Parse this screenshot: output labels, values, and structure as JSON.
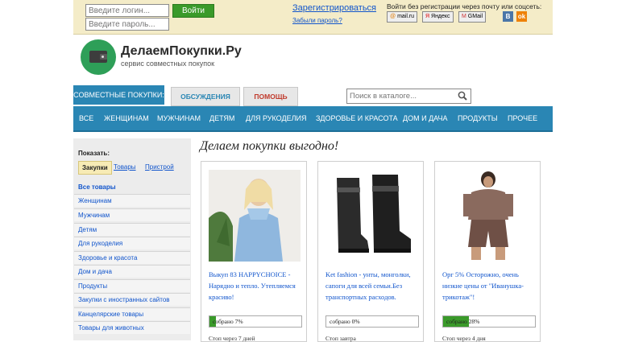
{
  "login": {
    "login_placeholder": "Введите логин...",
    "password_placeholder": "Введите пароль...",
    "submit_label": "Войти",
    "register_link": "Зарегистрироваться",
    "forgot_link": "Забыли пароль?"
  },
  "social": {
    "title": "Войти без регистрации через почту или соцсеть:",
    "buttons": [
      "mail.ru",
      "Яндекс",
      "GMail"
    ],
    "vk": "B",
    "ok": "ok"
  },
  "header": {
    "site_title": "ДелаемПокупки.Ру",
    "tagline": "сервис совместных покупок"
  },
  "tabs": {
    "joint_purchases": "СОВМЕСТНЫЕ ПОКУПКИ:",
    "discussions": "ОБСУЖДЕНИЯ",
    "help": "ПОМОЩЬ"
  },
  "search": {
    "placeholder": "Поиск в каталоге..."
  },
  "nav": [
    "ВСЕ",
    "ЖЕНЩИНАМ",
    "МУЖЧИНАМ",
    "ДЕТЯМ",
    "ДЛЯ РУКОДЕЛИЯ",
    "ЗДОРОВЬЕ И КРАСОТА",
    "ДОМ И ДАЧА",
    "ПРОДУКТЫ",
    "ПРОЧЕЕ"
  ],
  "sidebar": {
    "show_label": "Показать:",
    "filters": [
      "Закупки",
      "Товары",
      "Пристрой"
    ],
    "all_goods": "Все товары",
    "categories": [
      "Женщинам",
      "Мужчинам",
      "Детям",
      "Для рукоделия",
      "Здоровье и красота",
      "Дом и дача",
      "Продукты",
      "Закупки с иностранных сайтов",
      "Канцелярские товары",
      "Товары для животных"
    ]
  },
  "main": {
    "title": "Делаем покупки выгодно!",
    "cards": [
      {
        "text": "Выкуп 83 HAPPYCHOICE - Нарядно и тепло. Утепляемся красиво!",
        "progress_label": "собрано 7%",
        "progress": 7,
        "stop": "Стоп через 7 дней"
      },
      {
        "text": "Ket fashion - унты, монголки, сапоги для всей семьи.Без транспортных расходов.",
        "progress_label": "собрано 0%",
        "progress": 0,
        "stop": "Стоп завтра"
      },
      {
        "text": "Орг 5% Осторожно, очень низкие цены от \"Иванушка-трикотаж\"!",
        "progress_label": "собрано 28%",
        "progress": 28,
        "stop": "Стоп через 4 дня"
      }
    ]
  },
  "colors": {
    "accent_blue": "#2a86b4",
    "login_bar": "#f4ecc8",
    "login_button": "#3a9a2a",
    "logo_green": "#2e9f58",
    "progress_green": "#3a9a2a"
  }
}
